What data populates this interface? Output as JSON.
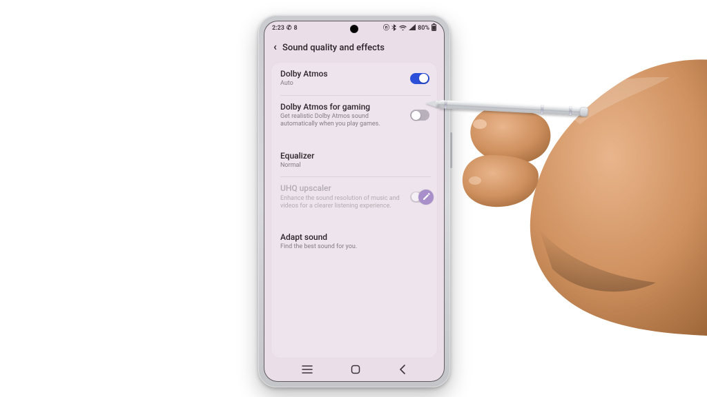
{
  "status": {
    "time": "2:23",
    "notif_count": "8",
    "battery_text": "80%"
  },
  "header": {
    "title": "Sound quality and effects"
  },
  "rows": {
    "dolby": {
      "title": "Dolby Atmos",
      "sub": "Auto",
      "on": true
    },
    "dolby_gaming": {
      "title": "Dolby Atmos for gaming",
      "sub": "Get realistic Dolby Atmos sound automatically when you play games.",
      "on": false
    },
    "equalizer": {
      "title": "Equalizer",
      "sub": "Normal"
    },
    "uhq": {
      "title": "UHQ upscaler",
      "sub": "Enhance the sound resolution of music and videos for a clearer listening experience.",
      "on": false
    },
    "adapt": {
      "title": "Adapt sound",
      "sub": "Find the best sound for you."
    }
  },
  "icons": {
    "phone": "phone-icon",
    "nfc": "nfc-icon",
    "bluetooth": "bluetooth-icon",
    "wifi": "wifi-icon",
    "signal": "signal-icon",
    "battery": "battery-icon",
    "back": "chevron-left-icon",
    "recents": "recents-icon",
    "home": "home-icon",
    "nav_back": "back-icon",
    "stylus": "stylus-icon",
    "pen_badge": "edit-icon"
  }
}
